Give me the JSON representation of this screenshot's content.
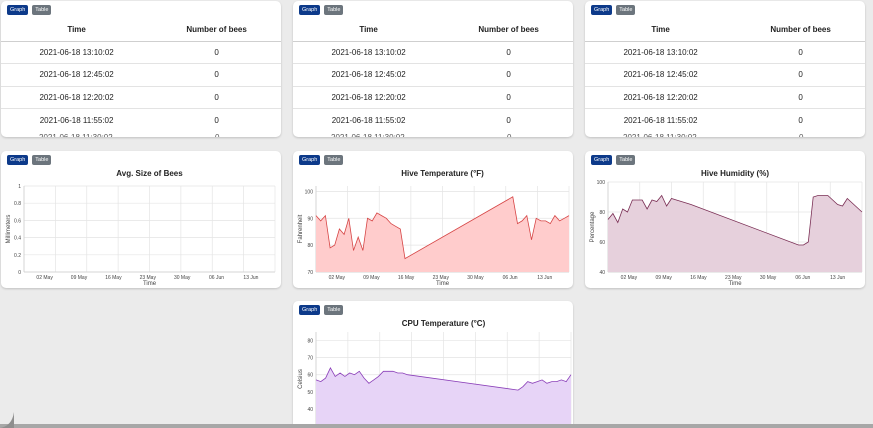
{
  "buttons": {
    "graph": "Graph",
    "table": "Table"
  },
  "tables": [
    {
      "headers": [
        "Time",
        "Number of bees"
      ],
      "rows": [
        [
          "2021-06-18 13:10:02",
          "0"
        ],
        [
          "2021-06-18 12:45:02",
          "0"
        ],
        [
          "2021-06-18 12:20:02",
          "0"
        ],
        [
          "2021-06-18 11:55:02",
          "0"
        ]
      ]
    },
    {
      "headers": [
        "Time",
        "Number of bees"
      ],
      "rows": [
        [
          "2021-06-18 13:10:02",
          "0"
        ],
        [
          "2021-06-18 12:45:02",
          "0"
        ],
        [
          "2021-06-18 12:20:02",
          "0"
        ],
        [
          "2021-06-18 11:55:02",
          "0"
        ]
      ]
    },
    {
      "headers": [
        "Time",
        "Number of bees"
      ],
      "rows": [
        [
          "2021-06-18 13:10:02",
          "0"
        ],
        [
          "2021-06-18 12:45:02",
          "0"
        ],
        [
          "2021-06-18 12:20:02",
          "0"
        ],
        [
          "2021-06-18 11:55:02",
          "0"
        ]
      ]
    }
  ],
  "chart_data": [
    {
      "id": "size",
      "type": "line",
      "title": "Avg. Size of Bees",
      "xlabel": "Time",
      "ylabel": "Millimeters",
      "ylim": [
        0,
        1
      ],
      "yticks": [
        "0",
        "0.2",
        "0.4",
        "0.6",
        "0.8",
        "1"
      ],
      "xticks": [
        "02 May",
        "09 May",
        "16 May",
        "23 May",
        "30 May",
        "06 Jun",
        "13 Jun"
      ],
      "grid": true,
      "series": [
        {
          "color": "#888888",
          "fill": "none",
          "x": [],
          "y": []
        }
      ]
    },
    {
      "id": "temp",
      "type": "area",
      "title": "Hive Temperature (°F)",
      "xlabel": "Time",
      "ylabel": "Fahrenheit",
      "ylim": [
        70,
        102
      ],
      "yticks": [
        "70",
        "80",
        "90",
        "100"
      ],
      "xticks": [
        "02 May",
        "09 May",
        "16 May",
        "23 May",
        "30 May",
        "06 Jun",
        "13 Jun"
      ],
      "grid": true,
      "series": [
        {
          "color": "#d64545",
          "fill": "#ffcccc",
          "x": [
            0,
            1,
            2,
            3,
            4,
            5,
            6,
            7,
            8,
            9,
            10,
            11,
            12,
            13,
            14,
            15,
            16,
            17,
            18,
            19,
            42,
            43,
            44,
            45,
            46,
            47,
            48,
            49,
            50,
            51,
            52,
            53,
            54
          ],
          "y": [
            91,
            89,
            91,
            79,
            80,
            86,
            84,
            90,
            78,
            83,
            78,
            90,
            89,
            92,
            91,
            90,
            88,
            87,
            86,
            75,
            98,
            88,
            89,
            91,
            82,
            90,
            89,
            89,
            88,
            91,
            89,
            90,
            91
          ]
        }
      ]
    },
    {
      "id": "humidity",
      "type": "area",
      "title": "Hive Humidity (%)",
      "xlabel": "Time",
      "ylabel": "Percentage",
      "ylim": [
        40,
        100
      ],
      "yticks": [
        "40",
        "60",
        "80",
        "100"
      ],
      "xticks": [
        "02 May",
        "09 May",
        "16 May",
        "23 May",
        "30 May",
        "06 Jun",
        "13 Jun"
      ],
      "grid": true,
      "series": [
        {
          "color": "#7a2e54",
          "fill": "#e6d0dc",
          "x": [
            0,
            1,
            2,
            3,
            4,
            5,
            6,
            7,
            8,
            9,
            10,
            11,
            12,
            13,
            14,
            15,
            16,
            17,
            39,
            40,
            41,
            42,
            43,
            44,
            45,
            46,
            47,
            48,
            49,
            50,
            51,
            52
          ],
          "y": [
            75,
            79,
            73,
            82,
            80,
            88,
            88,
            88,
            82,
            88,
            87,
            91,
            84,
            89,
            88,
            87,
            86,
            85,
            58,
            58,
            60,
            90,
            91,
            91,
            91,
            88,
            85,
            84,
            89,
            86,
            83,
            80
          ]
        }
      ]
    },
    {
      "id": "cpu",
      "type": "area",
      "title": "CPU Temperature (°C)",
      "xlabel": "",
      "ylabel": "Celsius",
      "ylim": [
        30,
        85
      ],
      "yticks": [
        "40",
        "50",
        "60",
        "70",
        "80"
      ],
      "xticks": [],
      "grid": true,
      "series": [
        {
          "color": "#8a3fb8",
          "fill": "#e7d4f7",
          "x": [
            0,
            1,
            2,
            3,
            4,
            5,
            6,
            7,
            8,
            9,
            10,
            11,
            12,
            13,
            14,
            15,
            16,
            17,
            18,
            19,
            42,
            43,
            44,
            45,
            46,
            47,
            48,
            49,
            50,
            51,
            52,
            53
          ],
          "y": [
            57,
            56,
            58,
            64,
            59,
            61,
            59,
            61,
            60,
            62,
            58,
            55,
            57,
            59,
            62,
            62,
            62,
            61,
            61,
            60,
            51,
            53,
            56,
            55,
            56,
            57,
            55,
            56,
            56,
            57,
            56,
            60
          ]
        }
      ]
    }
  ]
}
